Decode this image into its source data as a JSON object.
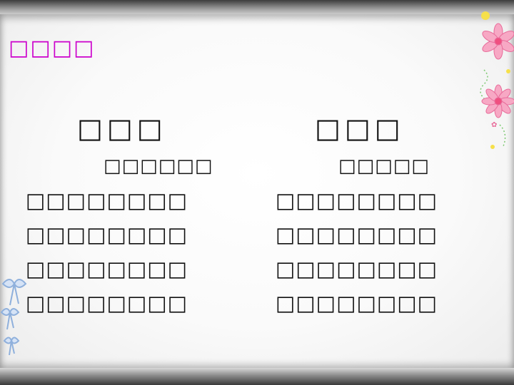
{
  "heading": "□□□□",
  "poems": [
    {
      "title": "□□□",
      "author": "□□□□□□",
      "lines": [
        "□□□□□□□□",
        "□□□□□□□□",
        "□□□□□□□□",
        "□□□□□□□□"
      ]
    },
    {
      "title": "□□□",
      "author": "□□□□□",
      "lines": [
        "□□□□□□□□",
        "□□□□□□□□",
        "□□□□□□□□",
        "□□□□□□□□"
      ]
    }
  ],
  "colors": {
    "heading": "#cc00cc",
    "text": "#111111",
    "flower": "#f07aa0"
  },
  "icons": [
    "flower-decoration-icon",
    "ribbon-bow-icon"
  ]
}
